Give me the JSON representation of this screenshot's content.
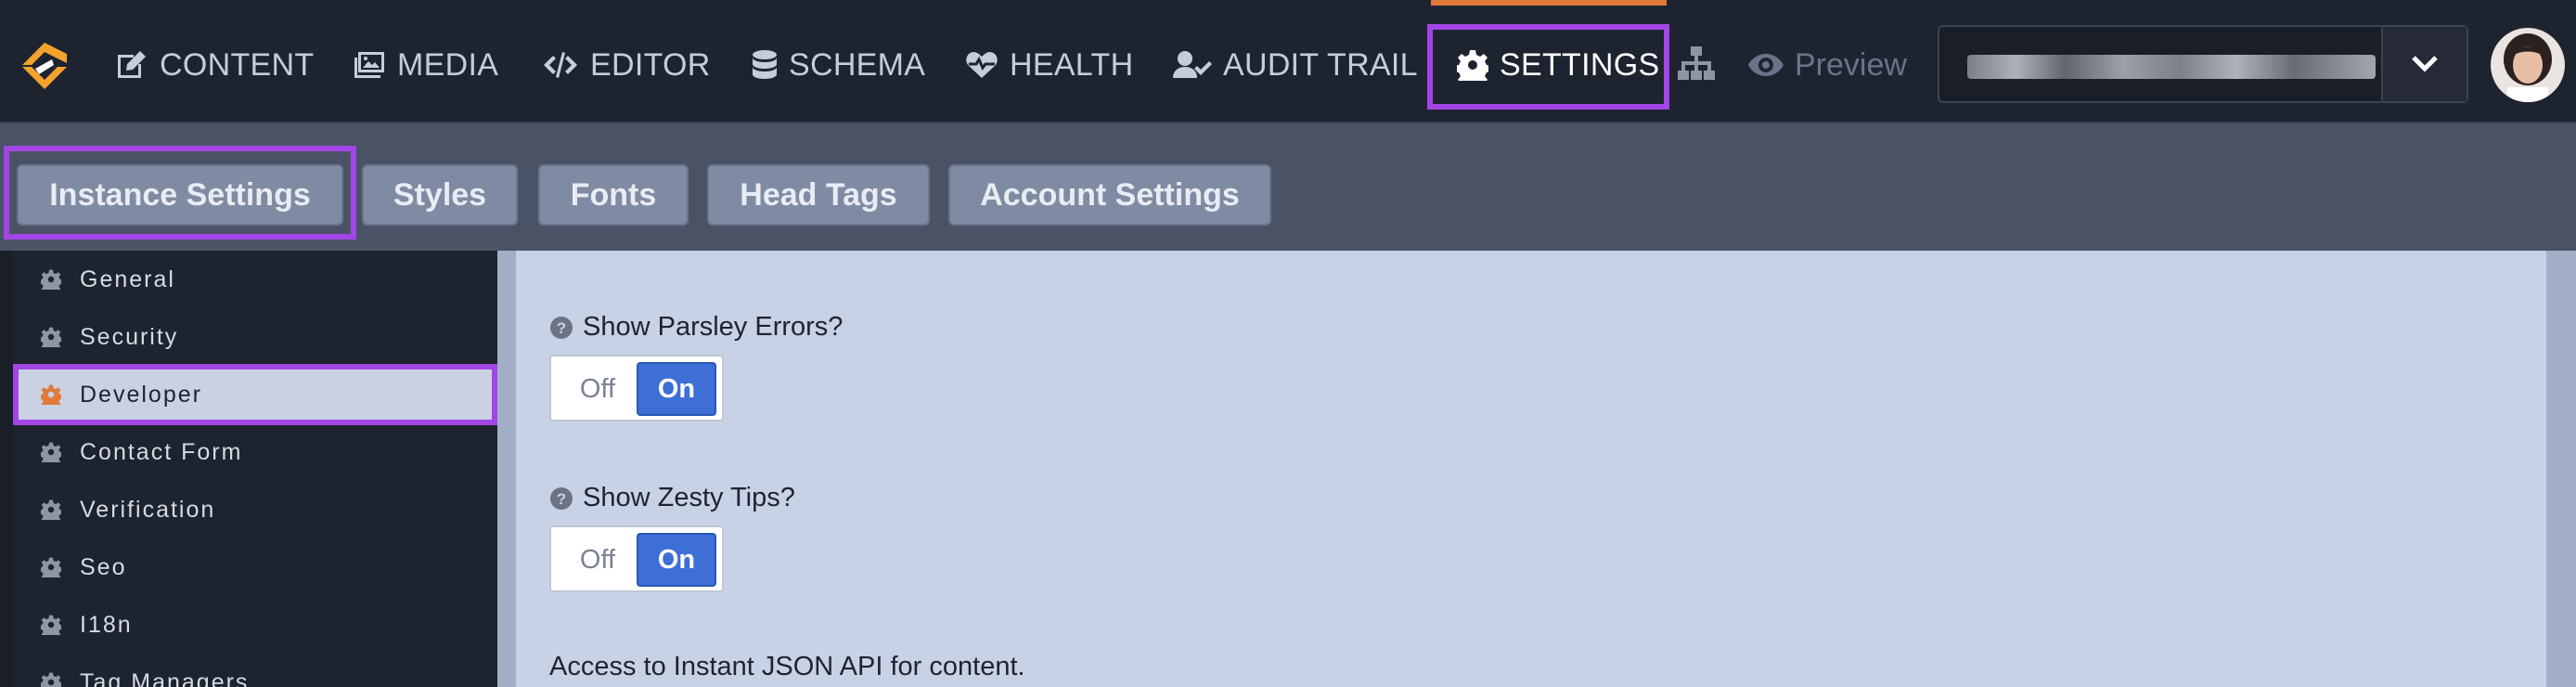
{
  "nav": {
    "items": [
      {
        "label": "CONTENT",
        "icon": "edit-icon"
      },
      {
        "label": "MEDIA",
        "icon": "images-icon"
      },
      {
        "label": "EDITOR",
        "icon": "code-icon"
      },
      {
        "label": "SCHEMA",
        "icon": "database-icon"
      },
      {
        "label": "HEALTH",
        "icon": "heartbeat-icon"
      },
      {
        "label": "AUDIT TRAIL",
        "icon": "user-check-icon"
      },
      {
        "label": "SETTINGS",
        "icon": "gear-icon"
      }
    ],
    "active": "SETTINGS",
    "preview_label": "Preview"
  },
  "tabs": {
    "items": [
      "Instance Settings",
      "Styles",
      "Fonts",
      "Head Tags",
      "Account Settings"
    ],
    "active": "Instance Settings"
  },
  "sidebar": {
    "items": [
      "General",
      "Security",
      "Developer",
      "Contact Form",
      "Verification",
      "Seo",
      "I18n",
      "Tag Managers"
    ],
    "active": "Developer"
  },
  "settings": {
    "parsley": {
      "label": "Show Parsley Errors?",
      "off": "Off",
      "on": "On",
      "value": "On"
    },
    "tips": {
      "label": "Show Zesty Tips?",
      "off": "Off",
      "on": "On",
      "value": "On"
    },
    "api_text": "Access to Instant JSON API for content."
  },
  "colors": {
    "highlight": "#a346e6",
    "accent": "#e07a3a",
    "toggle_on": "#3d6fd6"
  }
}
